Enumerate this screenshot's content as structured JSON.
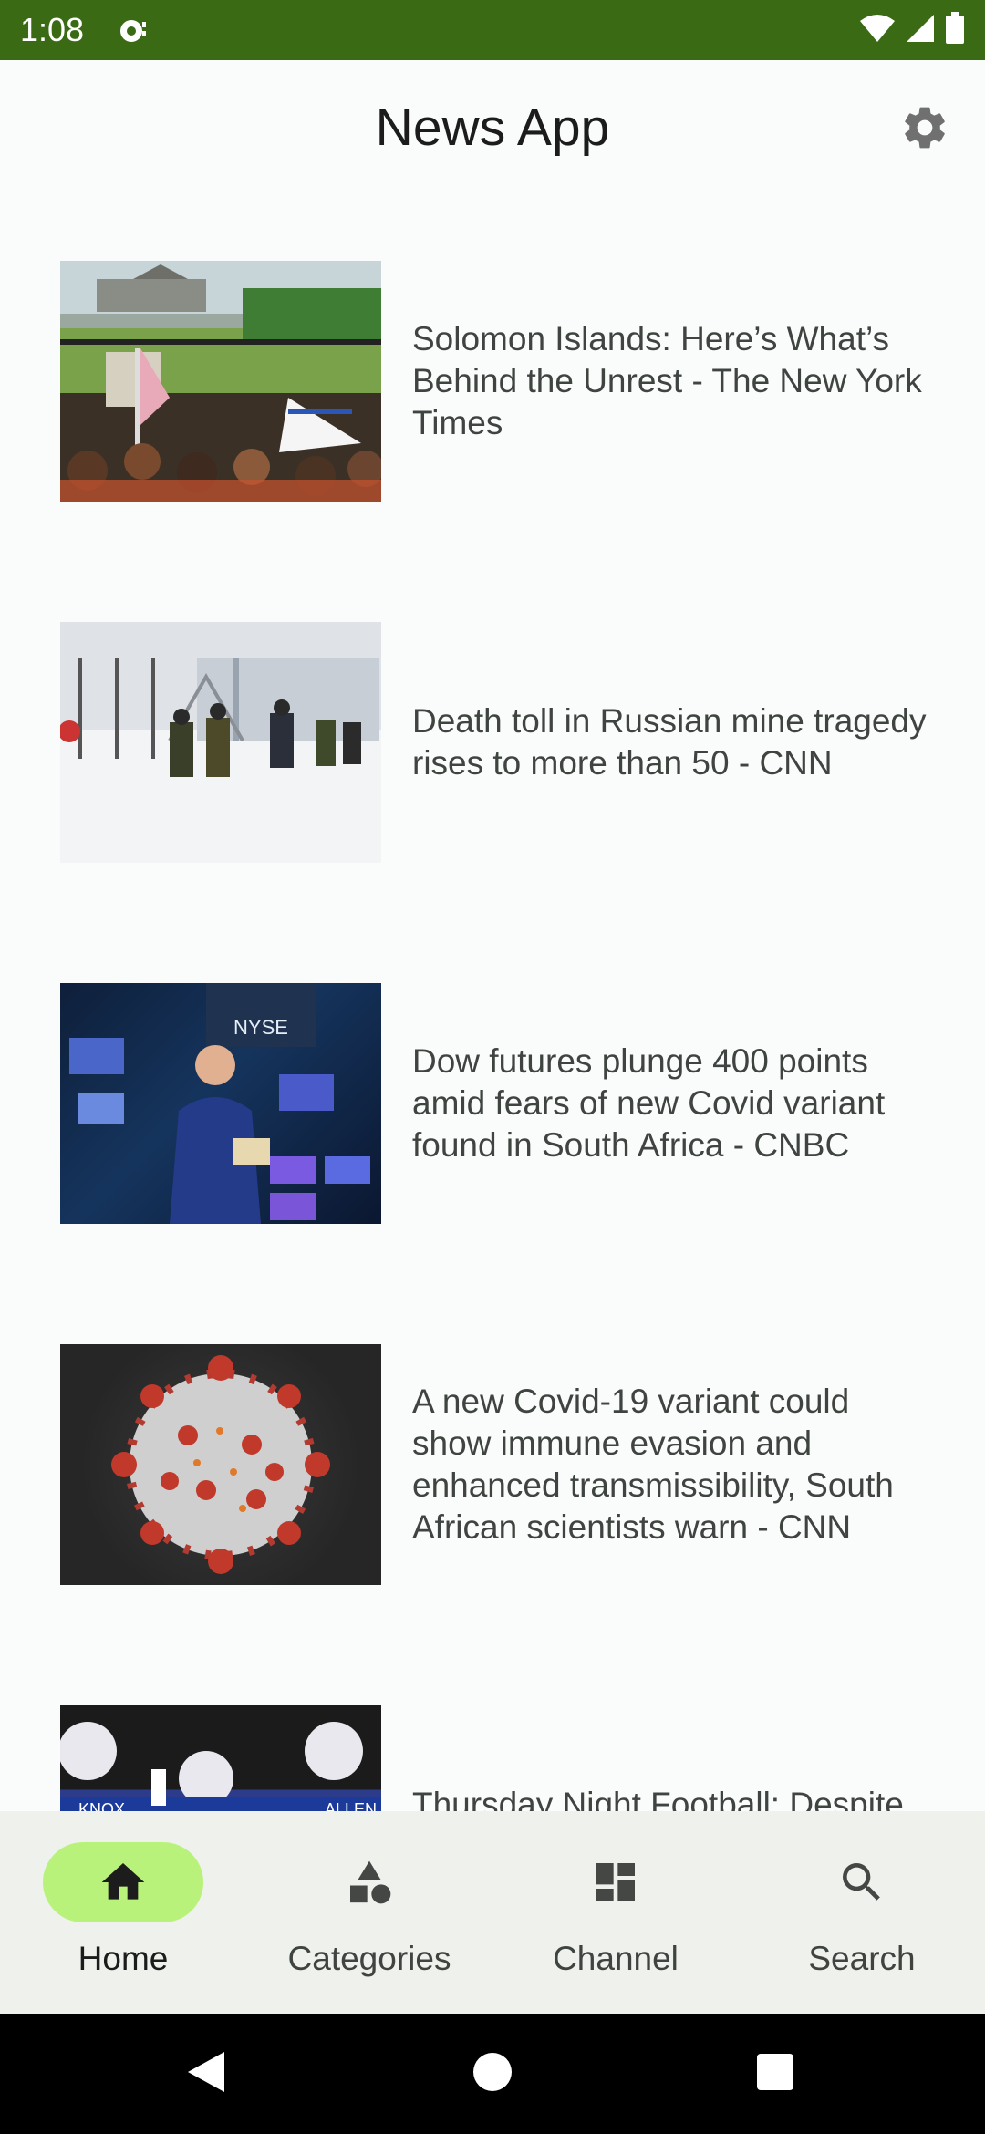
{
  "status_bar": {
    "time": "1:08"
  },
  "app": {
    "title": "News App"
  },
  "articles": [
    {
      "headline": "Solomon Islands: Here’s What’s Behind the Unrest - The New York Times"
    },
    {
      "headline": "Death toll in Russian mine tragedy rises to more than 50 - CNN"
    },
    {
      "headline": "Dow futures plunge 400 points amid fears of new Covid variant found in South Africa - CNBC"
    },
    {
      "headline": "A new Covid-19 variant could show immune evasion and enhanced transmissibility, South African scientists warn - CNN"
    },
    {
      "headline": "Thursday Night Football: Despite two Josh Allen"
    }
  ],
  "bottom_nav": {
    "items": [
      {
        "label": "Home",
        "icon": "home-icon",
        "active": true
      },
      {
        "label": "Categories",
        "icon": "shapes-icon",
        "active": false
      },
      {
        "label": "Channel",
        "icon": "dashboard-icon",
        "active": false
      },
      {
        "label": "Search",
        "icon": "search-icon",
        "active": false
      }
    ]
  },
  "colors": {
    "status_bar": "#3a6b14",
    "active_pill": "#b8f27b",
    "nav_background": "#eef1ec",
    "background": "#fafcfb"
  }
}
